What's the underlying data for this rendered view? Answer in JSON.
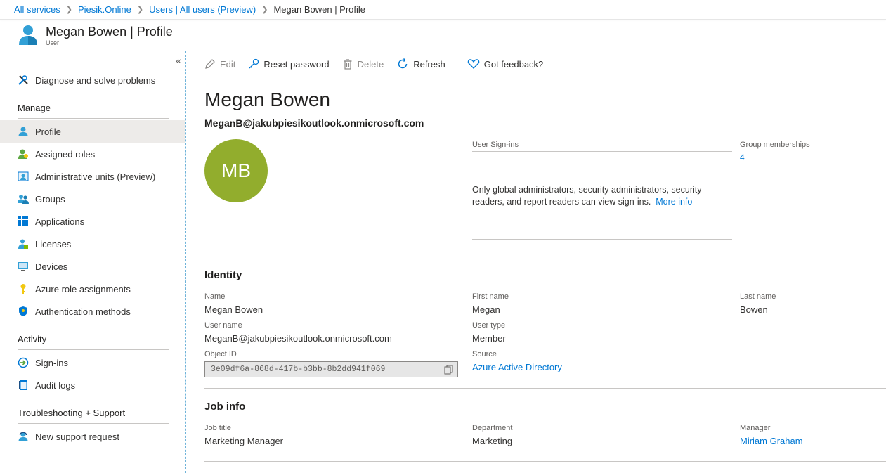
{
  "breadcrumb": {
    "items": [
      "All services",
      "Piesik.Online",
      "Users | All users (Preview)"
    ],
    "current": "Megan Bowen | Profile"
  },
  "header": {
    "title": "Megan Bowen | Profile",
    "subtitle": "User",
    "icon": "user-icon"
  },
  "sidebar": {
    "collapse_label": "«",
    "top_item": {
      "label": "Diagnose and solve problems",
      "icon": "wrench-icon"
    },
    "sections": [
      {
        "title": "Manage",
        "items": [
          {
            "label": "Profile",
            "icon": "user-icon",
            "active": true
          },
          {
            "label": "Assigned roles",
            "icon": "assigned-roles-icon"
          },
          {
            "label": "Administrative units (Preview)",
            "icon": "admin-units-icon"
          },
          {
            "label": "Groups",
            "icon": "groups-icon"
          },
          {
            "label": "Applications",
            "icon": "applications-grid-icon"
          },
          {
            "label": "Licenses",
            "icon": "licenses-icon"
          },
          {
            "label": "Devices",
            "icon": "devices-icon"
          },
          {
            "label": "Azure role assignments",
            "icon": "key-icon"
          },
          {
            "label": "Authentication methods",
            "icon": "shield-icon"
          }
        ]
      },
      {
        "title": "Activity",
        "items": [
          {
            "label": "Sign-ins",
            "icon": "sign-ins-icon"
          },
          {
            "label": "Audit logs",
            "icon": "audit-logs-icon"
          }
        ]
      },
      {
        "title": "Troubleshooting + Support",
        "items": [
          {
            "label": "New support request",
            "icon": "support-user-icon"
          }
        ]
      }
    ]
  },
  "toolbar": {
    "edit": "Edit",
    "reset_password": "Reset password",
    "delete": "Delete",
    "refresh": "Refresh",
    "feedback": "Got feedback?"
  },
  "profile": {
    "display_name": "Megan Bowen",
    "upn": "MeganB@jakubpiesikoutlook.onmicrosoft.com",
    "initials": "MB",
    "avatar_color": "#92ad2d"
  },
  "signins": {
    "label": "User Sign-ins",
    "message": "Only global administrators, security administrators, security readers, and report readers can view sign-ins.",
    "more_info": "More info"
  },
  "groups": {
    "label": "Group memberships",
    "count": "4"
  },
  "identity": {
    "title": "Identity",
    "name_label": "Name",
    "name": "Megan Bowen",
    "first_name_label": "First name",
    "first_name": "Megan",
    "last_name_label": "Last name",
    "last_name": "Bowen",
    "user_name_label": "User name",
    "user_name": "MeganB@jakubpiesikoutlook.onmicrosoft.com",
    "user_type_label": "User type",
    "user_type": "Member",
    "object_id_label": "Object ID",
    "object_id": "3e09df6a-868d-417b-b3bb-8b2dd941f069",
    "source_label": "Source",
    "source": "Azure Active Directory"
  },
  "job_info": {
    "title": "Job info",
    "job_title_label": "Job title",
    "job_title": "Marketing Manager",
    "department_label": "Department",
    "department": "Marketing",
    "manager_label": "Manager",
    "manager": "Miriam Graham"
  },
  "colors": {
    "link": "#0078d4",
    "accent_dashed": "#6fb3d9",
    "active_nav": "#edebe9"
  }
}
